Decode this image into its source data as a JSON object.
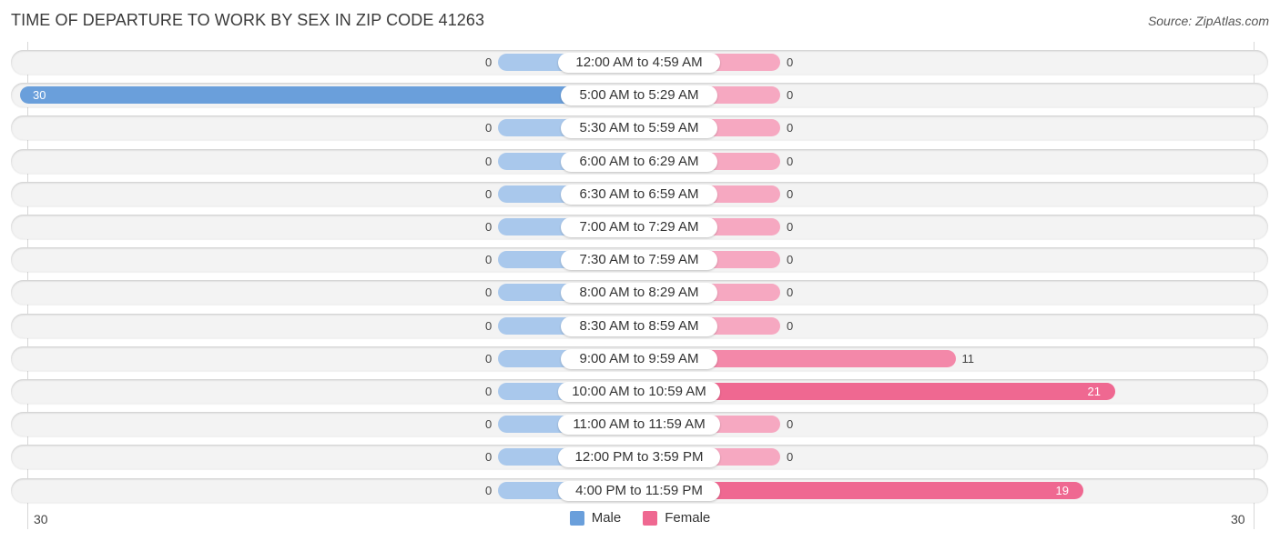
{
  "title": "TIME OF DEPARTURE TO WORK BY SEX IN ZIP CODE 41263",
  "source": "Source: ZipAtlas.com",
  "colors": {
    "male": "#6a9fdb",
    "male_light": "#a9c8ec",
    "female": "#ef6891",
    "female_light": "#f6a8c1"
  },
  "chart_data": {
    "type": "bar",
    "orientation": "horizontal-diverging",
    "title": "TIME OF DEPARTURE TO WORK BY SEX IN ZIP CODE 41263",
    "categories": [
      "12:00 AM to 4:59 AM",
      "5:00 AM to 5:29 AM",
      "5:30 AM to 5:59 AM",
      "6:00 AM to 6:29 AM",
      "6:30 AM to 6:59 AM",
      "7:00 AM to 7:29 AM",
      "7:30 AM to 7:59 AM",
      "8:00 AM to 8:29 AM",
      "8:30 AM to 8:59 AM",
      "9:00 AM to 9:59 AM",
      "10:00 AM to 10:59 AM",
      "11:00 AM to 11:59 AM",
      "12:00 PM to 3:59 PM",
      "4:00 PM to 11:59 PM"
    ],
    "series": [
      {
        "name": "Male",
        "values": [
          0,
          30,
          0,
          0,
          0,
          0,
          0,
          0,
          0,
          0,
          0,
          0,
          0,
          0
        ]
      },
      {
        "name": "Female",
        "values": [
          0,
          0,
          0,
          0,
          0,
          0,
          0,
          0,
          0,
          11,
          21,
          0,
          0,
          19
        ]
      }
    ],
    "xlim": [
      30,
      30
    ],
    "axis_ticks": {
      "left": "30",
      "right": "30"
    },
    "legend": {
      "position": "bottom-center",
      "entries": [
        "Male",
        "Female"
      ]
    },
    "grid": false
  }
}
